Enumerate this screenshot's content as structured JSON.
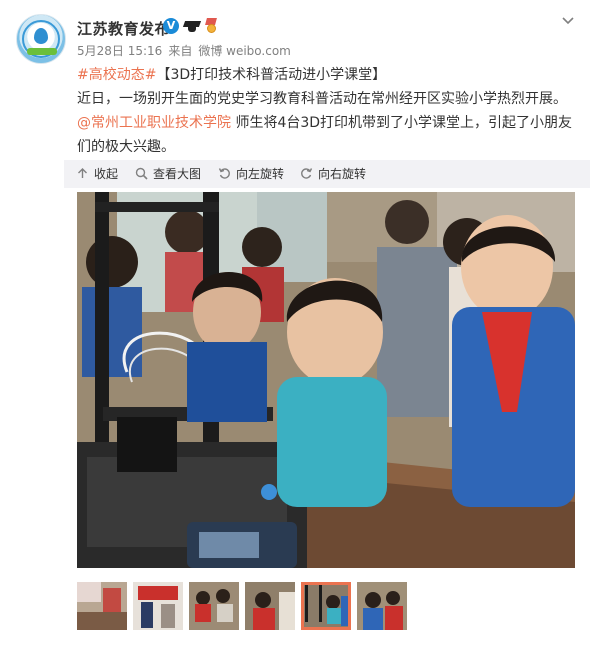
{
  "post": {
    "author": "江苏教育发布",
    "date": "5月28日 15:16",
    "source_prefix": "来自",
    "source": "微博 weibo.com",
    "topic": "#高校动态#",
    "headline": "【3D打印技术科普活动进小学课堂】",
    "line2": "近日，一场别开生面的党史学习教育科普活动在常州经开区实验小学热烈开展。",
    "mention": "@常州工业职业技术学院",
    "line3_rest": " 师生将4台3D打印机带到了小学课堂上，引起了小朋友",
    "line4": "们的极大兴趣。"
  },
  "toolbar": {
    "collapse": "收起",
    "view_large": "查看大图",
    "rotate_left": "向左旋转",
    "rotate_right": "向右旋转"
  },
  "icons": {
    "verified": "V",
    "collapse": "arrow-up-icon",
    "view_large": "magnifier-icon",
    "rotate_left": "rotate-left-icon",
    "rotate_right": "rotate-right-icon",
    "more": "chevron-down-icon"
  },
  "gallery": {
    "count": 6,
    "active_index": 4
  },
  "colors": {
    "link": "#eb7350",
    "verified": "#1a8bd8",
    "toolbar_bg": "#f2f2f5",
    "meta": "#808080"
  }
}
